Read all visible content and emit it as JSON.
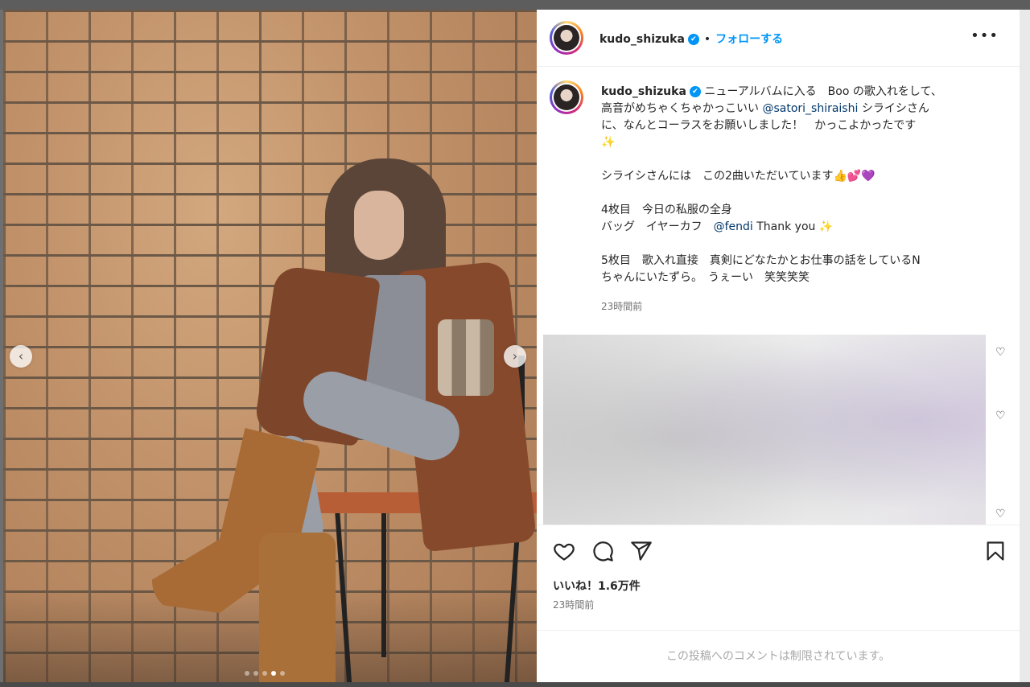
{
  "post": {
    "username": "kudo_shizuka",
    "verified_mark": "✔",
    "dot": "•",
    "follow_label": "フォローする",
    "more_label": "•••"
  },
  "caption": {
    "line1_a": "ニューアルバムに入る　Boo の歌入れをして、",
    "line2_a": "高音がめちゃくちゃかっこいい ",
    "mention_satori": "@satori_shiraishi",
    "line2_b": " シライシさん",
    "line3": "に、なんとコーラスをお願いしました！　かっこよかったです",
    "sparkle": "✨",
    "para2": "シライシさんには　この2曲いただいています👍💕💜",
    "para3_line1": "4枚目　今日の私服の全身",
    "para3_line2_a": "バッグ　イヤーカフ　",
    "mention_fendi": "@fendi",
    "para3_line2_b": " Thank you ",
    "para4_line1": "5枚目　歌入れ直接　真剣にどなたかとお仕事の話をしているN",
    "para4_line2": "ちゃんにいたずら。　うぇーい　笑笑笑笑",
    "time": "23時間前"
  },
  "engagement": {
    "likes": "いいね！1.6万件",
    "time": "23時間前",
    "comment_restricted": "この投稿へのコメントは制限されています。"
  },
  "carousel": {
    "prev_icon": "‹",
    "next_icon": "›",
    "slides": 5,
    "active_slide": 4
  },
  "icons": {
    "like": "heart-icon",
    "comment": "comment-icon",
    "share": "share-icon",
    "save": "bookmark-icon",
    "small_heart": "♡"
  },
  "colors": {
    "accent": "#0095f6",
    "mention": "#00376b",
    "muted": "#737373"
  }
}
